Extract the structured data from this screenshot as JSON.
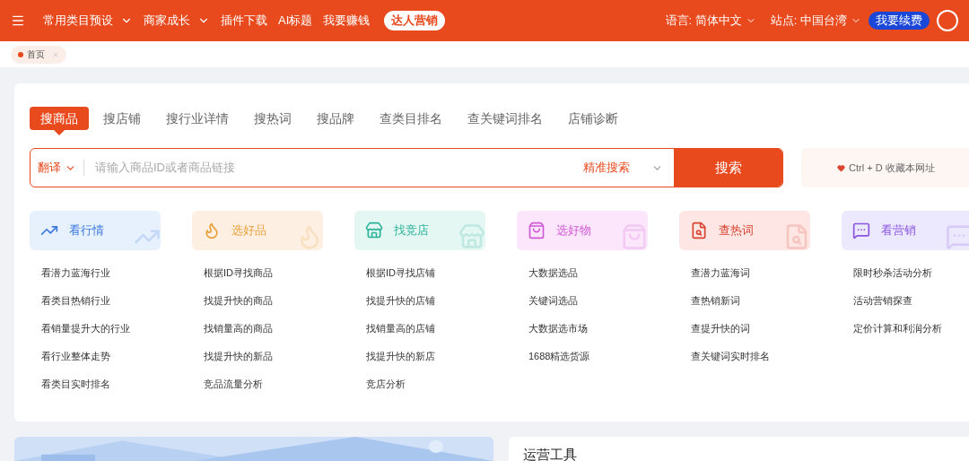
{
  "top_bar": {
    "menu": [
      {
        "label": "常用类目预设",
        "dropdown": true
      },
      {
        "label": "商家成长",
        "dropdown": true
      },
      {
        "label": "插件下载",
        "dropdown": false
      },
      {
        "label": "AI标题",
        "dropdown": false
      },
      {
        "label": "我要赚钱",
        "dropdown": false
      }
    ],
    "highlight_button": "达人营销",
    "language": "语言: 简体中文",
    "site": "站点: 中国台湾",
    "renew_button": "我要续费"
  },
  "page_tabs": [
    {
      "label": "首页",
      "selected": true
    }
  ],
  "search_tabs": [
    {
      "label": "搜商品",
      "selected": true
    },
    {
      "label": "搜店铺",
      "selected": false
    },
    {
      "label": "搜行业详情",
      "selected": false
    },
    {
      "label": "搜热词",
      "selected": false
    },
    {
      "label": "搜品牌",
      "selected": false
    },
    {
      "label": "查类目排名",
      "selected": false
    },
    {
      "label": "查关键词排名",
      "selected": false
    },
    {
      "label": "店铺诊断",
      "selected": false
    }
  ],
  "search": {
    "translate": "翻译",
    "placeholder": "请输入商品ID或者商品链接",
    "mode": "精准搜索",
    "button": "搜索"
  },
  "bookmark_hint": "Ctrl + D 收藏本网址",
  "categories": [
    {
      "kind": "market",
      "title": "看行情",
      "color": "#3a78e0",
      "links": [
        "看潜力蓝海行业",
        "看类目热销行业",
        "看销量提升大的行业",
        "看行业整体走势",
        "看类目实时排名"
      ]
    },
    {
      "kind": "product",
      "title": "选好品",
      "color": "#e8a03a",
      "links": [
        "根据ID寻找商品",
        "找提升快的商品",
        "找销量高的商品",
        "找提升快的新品",
        "竞品流量分析"
      ]
    },
    {
      "kind": "shop",
      "title": "找竞店",
      "color": "#2bb39a",
      "links": [
        "根据ID寻找店铺",
        "找提升快的店铺",
        "找销量高的店铺",
        "找提升快的新店",
        "竞店分析"
      ]
    },
    {
      "kind": "goods",
      "title": "选好物",
      "color": "#d05ad6",
      "links": [
        "大数据选品",
        "关键词选品",
        "大数据选市场",
        "1688精选货源"
      ]
    },
    {
      "kind": "keyword",
      "title": "查热词",
      "color": "#d9442f",
      "links": [
        "查潜力蓝海词",
        "查热销新词",
        "查提升快的词",
        "查关键词实时排名"
      ]
    },
    {
      "kind": "marketing",
      "title": "看营销",
      "color": "#8a56e0",
      "links": [
        "限时秒杀活动分析",
        "活动营销探查",
        "定价计算和利润分析"
      ]
    }
  ],
  "bottom": {
    "tools_title": "运营工具"
  }
}
